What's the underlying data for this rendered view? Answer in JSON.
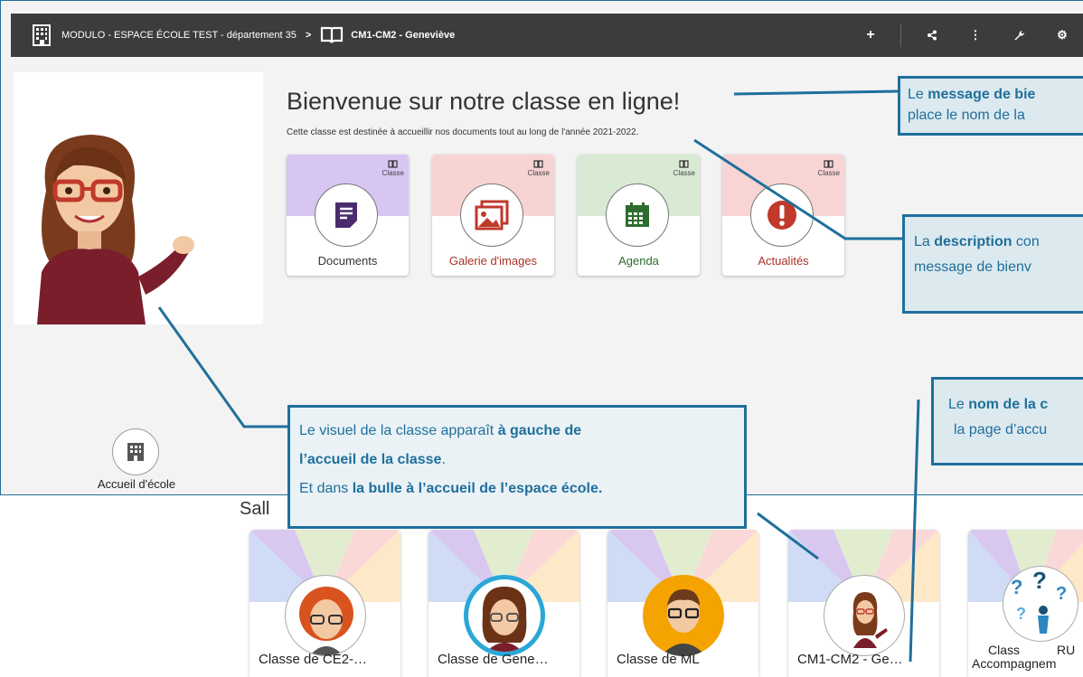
{
  "topbar": {
    "crumb_school": "MODULO - ESPACE ÉCOLE TEST - département 35",
    "separator": ">",
    "crumb_class": "CM1-CM2 - Geneviève",
    "tool_add": "+",
    "tool_share": "<",
    "tool_more": "⋮",
    "tool_wrench": "🔧",
    "tool_gear": "⚙"
  },
  "left": {
    "school_home_label": "Accueil d'école"
  },
  "welcome": {
    "title": "Bienvenue sur notre classe en ligne!",
    "description": "Cette classe est destinée à accueillir nos documents tout au long de l'année 2021-2022."
  },
  "cards": [
    {
      "label": "Documents",
      "badge": "Classe",
      "icon": "document-icon",
      "top_color": "#d7c6f2",
      "accent": "#4a2b6e",
      "label_color": "#333333"
    },
    {
      "label": "Galerie d'images",
      "badge": "Classe",
      "icon": "gallery-icon",
      "top_color": "#f7d3d3",
      "accent": "#c0392b",
      "label_color": "#a93226"
    },
    {
      "label": "Agenda",
      "badge": "Classe",
      "icon": "calendar-icon",
      "top_color": "#d8ead4",
      "accent": "#2f6b2f",
      "label_color": "#2f6b2f"
    },
    {
      "label": "Actualités",
      "badge": "Classe",
      "icon": "alert-icon",
      "top_color": "#f8d4d4",
      "accent": "#c0392b",
      "label_color": "#a93226"
    }
  ],
  "salles": {
    "title": "Sall",
    "rooms": [
      {
        "label": "Classe de CE2-…",
        "ring": "#ffffff",
        "avatar": "red-hair-avatar"
      },
      {
        "label": "Classe de Gene…",
        "ring": "#29a8d8",
        "avatar": "brunette-avatar"
      },
      {
        "label": "Classe de ML",
        "ring": "#f4a300",
        "avatar": "man-avatar"
      },
      {
        "label": "CM1-CM2 - Ge…",
        "ring": "#ffffff",
        "avatar": "teacher-avatar"
      },
      {
        "label": "Class",
        "label2": "RU",
        "label3": "Accompagnem",
        "ring": "#ffffff",
        "avatar": "question-avatar"
      }
    ]
  },
  "callouts": {
    "welcome_pre": "Le ",
    "welcome_bold": "message de bie",
    "welcome_line2": "place le nom de la",
    "desc_pre": "La ",
    "desc_bold": "description",
    "desc_post": " con",
    "desc_line2": "message de bienv",
    "name_pre": "Le ",
    "name_bold": "nom de la c",
    "name_line2": "la page d’accu",
    "visual_l1_pre": "Le visuel de la classe apparaît ",
    "visual_l1_bold": "à gauche de",
    "visual_l2_bold": "l’accueil de la classe",
    "visual_l2_post": ".",
    "visual_l3_pre": "Et dans ",
    "visual_l3_bold": "la bulle à l’accueil de l’espace école."
  },
  "colors": {
    "callout_border": "#1f6f9b",
    "topbar": "#3c3c3c"
  }
}
